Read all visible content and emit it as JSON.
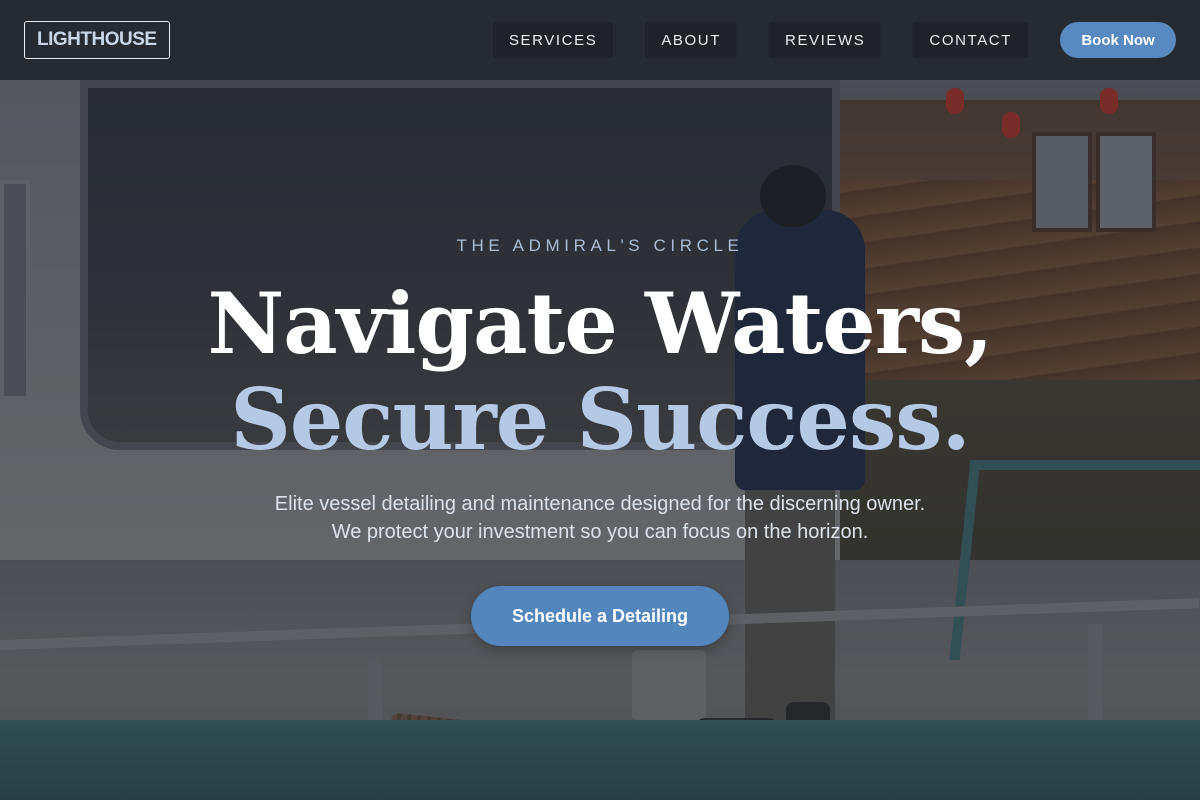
{
  "brand": {
    "logo_text": "LIGHTHOUSE"
  },
  "nav": {
    "items": [
      {
        "label": "SERVICES"
      },
      {
        "label": "ABOUT"
      },
      {
        "label": "REVIEWS"
      },
      {
        "label": "CONTACT"
      }
    ],
    "cta_label": "Book Now"
  },
  "hero": {
    "eyebrow": "THE ADMIRAL'S CIRCLE",
    "headline_line1": "Navigate Waters,",
    "headline_line2": "Secure Success.",
    "subtext": "Elite vessel detailing and maintenance designed for the discerning owner. We protect your investment so you can focus on the horizon.",
    "cta_label": "Schedule a Detailing"
  },
  "colors": {
    "accent": "#5889c0",
    "headline_secondary": "#b6c9e4",
    "header_bg": "#262a32"
  }
}
